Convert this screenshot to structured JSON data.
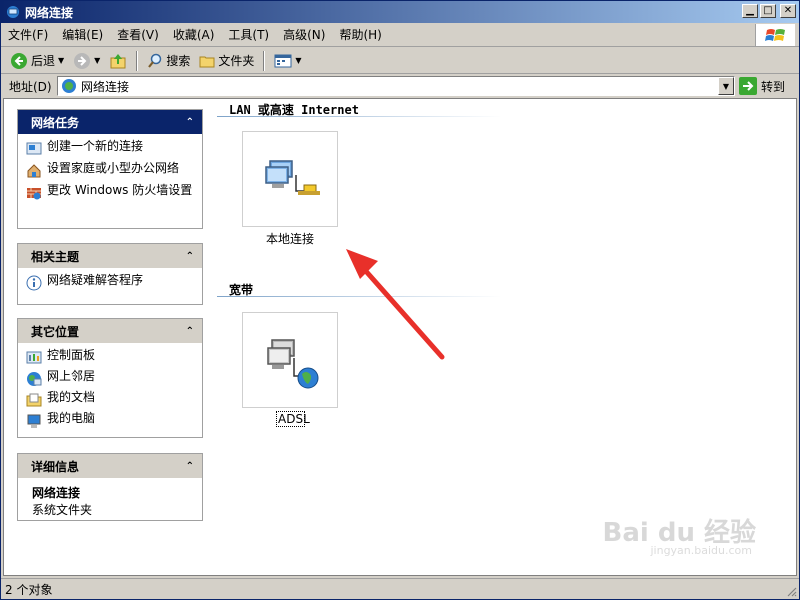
{
  "window": {
    "title": "网络连接"
  },
  "menubar": {
    "items": [
      "文件(F)",
      "编辑(E)",
      "查看(V)",
      "收藏(A)",
      "工具(T)",
      "高级(N)",
      "帮助(H)"
    ]
  },
  "toolbar": {
    "back_label": "后退",
    "search_label": "搜索",
    "folders_label": "文件夹"
  },
  "addressbar": {
    "label": "地址(D)",
    "value": "网络连接",
    "go_label": "转到"
  },
  "taskpane": {
    "network_tasks": {
      "title": "网络任务",
      "items": [
        {
          "label": "创建一个新的连接",
          "icon": "new-connection-icon"
        },
        {
          "label": "设置家庭或小型办公网络",
          "icon": "home-network-icon"
        },
        {
          "label": "更改 Windows 防火墙设置",
          "icon": "firewall-icon"
        }
      ]
    },
    "related_topics": {
      "title": "相关主题",
      "items": [
        {
          "label": "网络疑难解答程序",
          "icon": "info-icon"
        }
      ]
    },
    "other_places": {
      "title": "其它位置",
      "items": [
        {
          "label": "控制面板",
          "icon": "control-panel-icon"
        },
        {
          "label": "网上邻居",
          "icon": "network-places-icon"
        },
        {
          "label": "我的文档",
          "icon": "my-documents-icon"
        },
        {
          "label": "我的电脑",
          "icon": "my-computer-icon"
        }
      ]
    },
    "details": {
      "title": "详细信息",
      "name": "网络连接",
      "type": "系统文件夹"
    }
  },
  "main": {
    "sections": [
      {
        "title": "LAN 或高速 Internet",
        "items": [
          {
            "label": "本地连接",
            "icon": "lan-connection-icon"
          }
        ]
      },
      {
        "title": "宽带",
        "items": [
          {
            "label": "ADSL",
            "icon": "broadband-connection-icon"
          }
        ]
      }
    ]
  },
  "watermark": {
    "text": "Bai du 经验",
    "sub": "jingyan.baidu.com"
  },
  "statusbar": {
    "text": "2 个对象"
  },
  "colors": {
    "title_bar": "#0a246a",
    "accent_arrow": "#e8302a",
    "panel_head_active": "#0a246a"
  }
}
